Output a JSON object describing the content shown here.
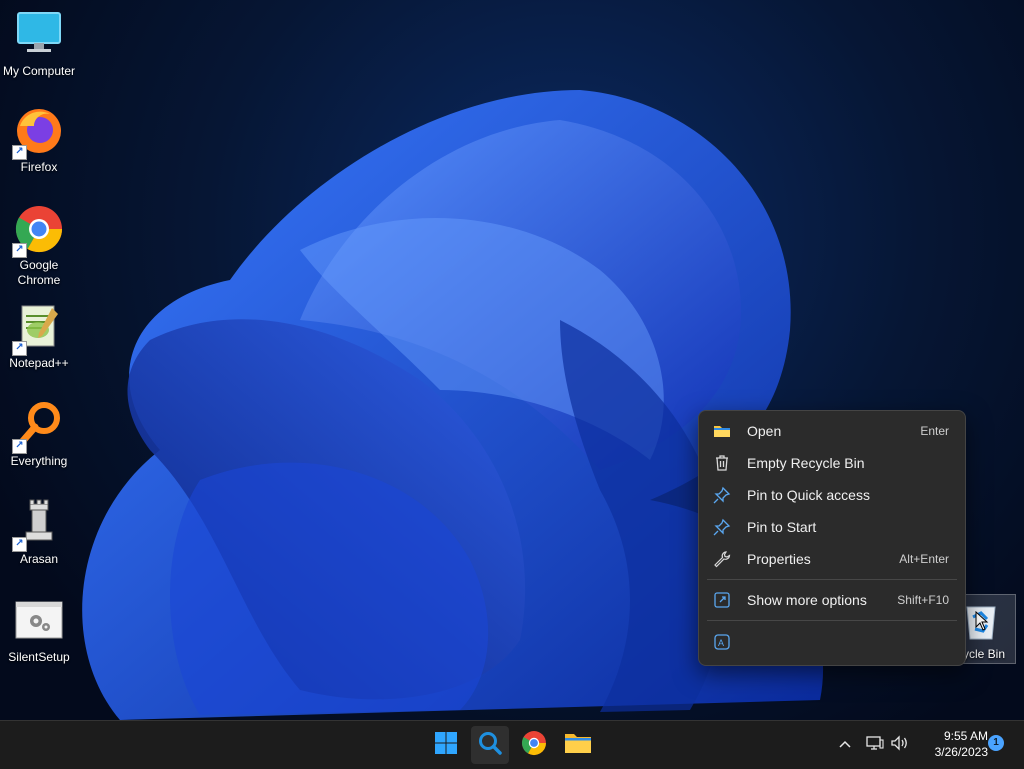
{
  "desktop_icons": [
    {
      "label": "My Computer",
      "icon": "monitor-icon"
    },
    {
      "label": "Firefox",
      "icon": "firefox-icon"
    },
    {
      "label": "Google Chrome",
      "icon": "chrome-icon"
    },
    {
      "label": "Notepad++",
      "icon": "notepadpp-icon"
    },
    {
      "label": "Everything",
      "icon": "everything-icon"
    },
    {
      "label": "Arasan",
      "icon": "arasan-icon"
    },
    {
      "label": "SilentSetup",
      "icon": "silentsetup-icon"
    }
  ],
  "recycle_bin": {
    "label": "ycle Bin",
    "icon": "recycle-bin-icon"
  },
  "context_menu": {
    "items": [
      {
        "label": "Open",
        "shortcut": "Enter",
        "icon": "folder-icon"
      },
      {
        "label": "Empty Recycle Bin",
        "shortcut": "",
        "icon": "trash-icon"
      },
      {
        "label": "Pin to Quick access",
        "shortcut": "",
        "icon": "pin-icon"
      },
      {
        "label": "Pin to Start",
        "shortcut": "",
        "icon": "pin-icon"
      },
      {
        "label": "Properties",
        "shortcut": "Alt+Enter",
        "icon": "wrench-icon"
      },
      {
        "label": "Show more options",
        "shortcut": "Shift+F10",
        "icon": "share-icon"
      }
    ],
    "bottom_icon": "ai-icon"
  },
  "taskbar": {
    "apps": [
      "start-icon",
      "search-icon",
      "chrome-icon",
      "file-explorer-icon"
    ],
    "tray": [
      "chevron-up-icon",
      "network-icon",
      "volume-icon"
    ],
    "time": "9:55 AM",
    "date": "3/26/2023",
    "notification_count": "1"
  },
  "colors": {
    "accent": "#4aa3ff",
    "menu_bg": "#2b2b2b",
    "taskbar_bg": "#1c1c1c"
  }
}
